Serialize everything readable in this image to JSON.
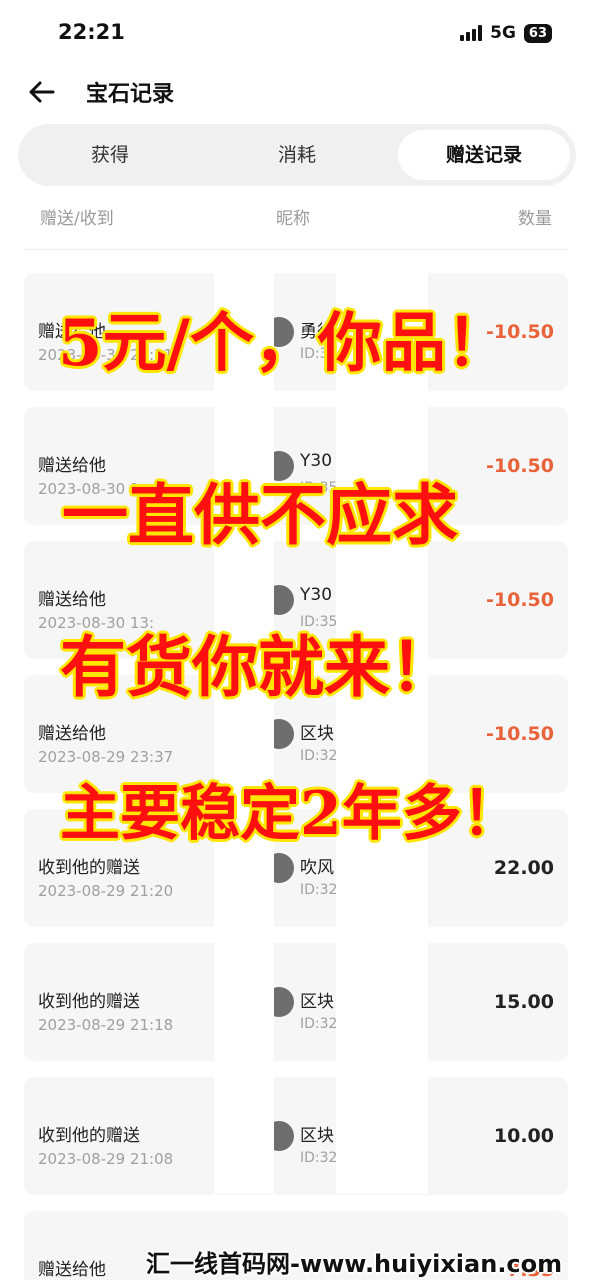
{
  "status_bar": {
    "time": "22:21",
    "network": "5G",
    "battery": "63"
  },
  "header": {
    "title": "宝石记录"
  },
  "tabs": [
    {
      "label": "获得",
      "active": false
    },
    {
      "label": "消耗",
      "active": false
    },
    {
      "label": "赠送记录",
      "active": true
    }
  ],
  "columns": {
    "col1": "赠送/收到",
    "col2": "昵称",
    "col3": "数量"
  },
  "records": [
    {
      "type": "赠送给他",
      "time": "2023-08-30 22:21",
      "nickname": "勇往",
      "uid": "ID:30",
      "amount": "-10.50"
    },
    {
      "type": "赠送给他",
      "time": "2023-08-30 1",
      "nickname": "Y30",
      "uid": "ID:35",
      "amount": "-10.50"
    },
    {
      "type": "赠送给他",
      "time": "2023-08-30 13:",
      "nickname": "Y30",
      "uid": "ID:35",
      "amount": "-10.50"
    },
    {
      "type": "赠送给他",
      "time": "2023-08-29 23:37",
      "nickname": "区块",
      "uid": "ID:32",
      "amount": "-10.50"
    },
    {
      "type": "收到他的赠送",
      "time": "2023-08-29 21:20",
      "nickname": "吹风",
      "uid": "ID:32",
      "amount": "22.00"
    },
    {
      "type": "收到他的赠送",
      "time": "2023-08-29 21:18",
      "nickname": "区块",
      "uid": "ID:32",
      "amount": "15.00"
    },
    {
      "type": "收到他的赠送",
      "time": "2023-08-29 21:08",
      "nickname": "区块",
      "uid": "ID:32",
      "amount": "10.00"
    },
    {
      "type": "赠送给他",
      "time": "",
      "nickname": "",
      "uid": "",
      "amount": "-7.35"
    }
  ],
  "overlay_text": {
    "line1": "5元/个，你品！",
    "line2": "一直供不应求",
    "line3": "有货你就来！",
    "line4": "主要稳定2年多！"
  },
  "watermark": "汇一线首码网-www.huiyixian.com",
  "colors": {
    "negative_amount": "#e8623a",
    "overlay_red": "#ff1010",
    "overlay_outline": "#ffe600"
  }
}
